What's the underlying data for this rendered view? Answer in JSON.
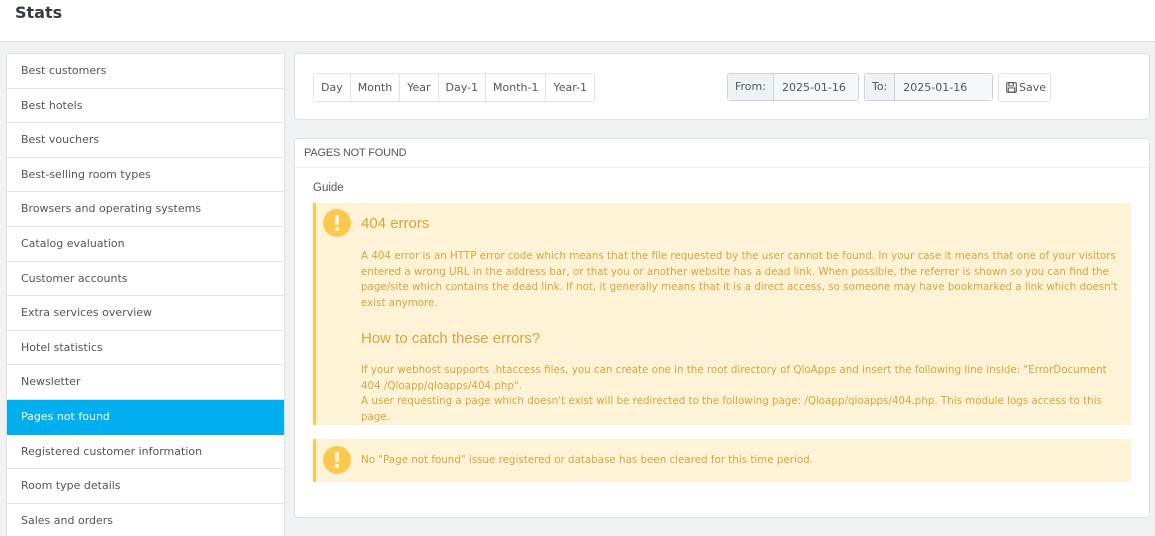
{
  "header": {
    "title": "Stats"
  },
  "sidebar": {
    "items": [
      {
        "label": "Best customers",
        "active": false
      },
      {
        "label": "Best hotels",
        "active": false
      },
      {
        "label": "Best vouchers",
        "active": false
      },
      {
        "label": "Best-selling room types",
        "active": false
      },
      {
        "label": "Browsers and operating systems",
        "active": false
      },
      {
        "label": "Catalog evaluation",
        "active": false
      },
      {
        "label": "Customer accounts",
        "active": false
      },
      {
        "label": "Extra services overview",
        "active": false
      },
      {
        "label": "Hotel statistics",
        "active": false
      },
      {
        "label": "Newsletter",
        "active": false
      },
      {
        "label": "Pages not found",
        "active": true
      },
      {
        "label": "Registered customer information",
        "active": false
      },
      {
        "label": "Room type details",
        "active": false
      },
      {
        "label": "Sales and orders",
        "active": false
      }
    ]
  },
  "toolbar": {
    "periods": [
      "Day",
      "Month",
      "Year",
      "Day-1",
      "Month-1",
      "Year-1"
    ],
    "from_label": "From:",
    "from_value": "2025-01-16",
    "to_label": "To:",
    "to_value": "2025-01-16",
    "save_label": "Save",
    "save_icon": "floppy-disk-icon"
  },
  "content": {
    "heading": "PAGES NOT FOUND",
    "guide_label": "Guide",
    "alert_icon": "exclamation-circle-icon",
    "section1_title": "404 errors",
    "section1_text": "A 404 error is an HTTP error code which means that the file requested by the user cannot be found. In your case it means that one of your visitors entered a wrong URL in the address bar, or that you or another website has a dead link. When possible, the referrer is shown so you can find the page/site which contains the dead link. If not, it generally means that it is a direct access, so someone may have bookmarked a link which doesn't exist anymore.",
    "section2_title": "How to catch these errors?",
    "section2_text1": "If your webhost supports .htaccess files, you can create one in the root directory of QloApps and insert the following line inside: \"ErrorDocument 404 /Qloapp/qloapps/404.php\".",
    "section2_text2": "A user requesting a page which doesn't exist will be redirected to the following page: /Qloapp/qloapps/404.php. This module logs access to this page.",
    "empty_message": "No \"Page not found\" issue registered or database has been cleared for this time period."
  },
  "colors": {
    "accent": "#00aff0",
    "warning_bg": "#fff3d7",
    "warning_border": "#fcc94f",
    "warning_text": "#d2a63c"
  }
}
